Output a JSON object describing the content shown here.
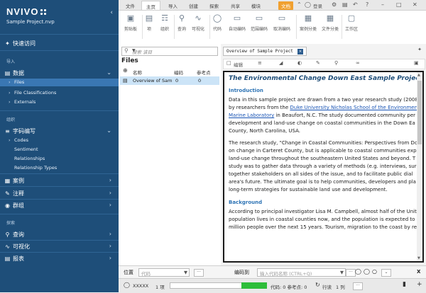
{
  "app": {
    "name": "NVIVO",
    "project": "Sample Project.nvp"
  },
  "sidebar": {
    "quick_access": "快速访问",
    "import_header": "导入",
    "data_label": "数据",
    "data_items": [
      "Files",
      "File Classifications",
      "Externals"
    ],
    "organize_header": "组织",
    "coding_label": "字码编写",
    "coding_items": [
      "Codes",
      "Sentiment",
      "Relationships",
      "Relationship Types"
    ],
    "cases_label": "案例",
    "notes_label": "注释",
    "sets_label": "群组",
    "explore_header": "探索",
    "query_label": "查询",
    "visualize_label": "可视化",
    "reports_label": "报表"
  },
  "menu_tabs": [
    "文件",
    "主页",
    "导入",
    "创建",
    "探索",
    "共享",
    "模块",
    "文档"
  ],
  "login_label": "登录",
  "ribbon": {
    "buttons": [
      "剪贴板",
      "项",
      "组织",
      "查询",
      "可视化",
      "代码",
      "自动编码",
      "范围编码",
      "取消编码",
      "案例分类",
      "文件分类",
      "工作区"
    ]
  },
  "files_pane": {
    "search_placeholder": "搜索 该目",
    "title": "Files",
    "columns": [
      "名称",
      "编码",
      "参考点"
    ],
    "rows": [
      {
        "name": "Overview of Sam",
        "codes": "0",
        "refs": "0"
      }
    ]
  },
  "doc_tab": {
    "title": "Overview of Sample Project"
  },
  "doc_toolbar": {
    "edit_label": "编辑"
  },
  "document": {
    "title": "The Environmental Change Down East Sample Project",
    "intro_heading": "Introduction",
    "intro_lines": [
      "Data in this sample project are drawn from a two year research study (2008",
      "by researchers from the ",
      "Marine Laboratory",
      " in Beaufort, N.C. The study documented community per",
      "development and land-use change on coastal communities in the Down Ea",
      "County, North Carolina, USA."
    ],
    "intro_link": "Duke University Nicholas School of the Environmen",
    "para2_lines": [
      "The research study, \"Change in Coastal Communities: Perspectives from Do",
      "on change in Carteret County, but is applicable to coastal communities exp",
      "land-use change throughout the southeastern United States and beyond. T",
      "study was to gather data through a variety of methods (e.g. interviews, sur",
      "together stakeholders on all sides of the issue, and to facilitate public dial",
      "area's future. The ultimate goal is to help communities, developers and pla",
      "long-term strategies for sustainable land use and development."
    ],
    "background_heading": "Background",
    "background_lines": [
      "According to principal investigator Lisa M. Campbell, almost half of the Unit",
      "population lives in coastal counties now, and the population is expected to",
      "million people over the next 15 years. Tourism, migration to the coast by re"
    ]
  },
  "bottom_bar": {
    "location_label": "位置",
    "location_placeholder": "代码",
    "coding_label": "编码到",
    "coding_placeholder": "输入代码名称 (CTRL+Q)",
    "close": "X"
  },
  "status_bar": {
    "user": "XXXXX",
    "items": "1 项",
    "coding_status": "代码: 0 参考点: 0",
    "row_label": "行读",
    "column_label": "1 列",
    "zoom": "+"
  },
  "colors": {
    "sidebar": "#1e4e79",
    "selected": "#3a77b3",
    "heading": "#1f4e79",
    "progress": "#2ebd3a"
  }
}
